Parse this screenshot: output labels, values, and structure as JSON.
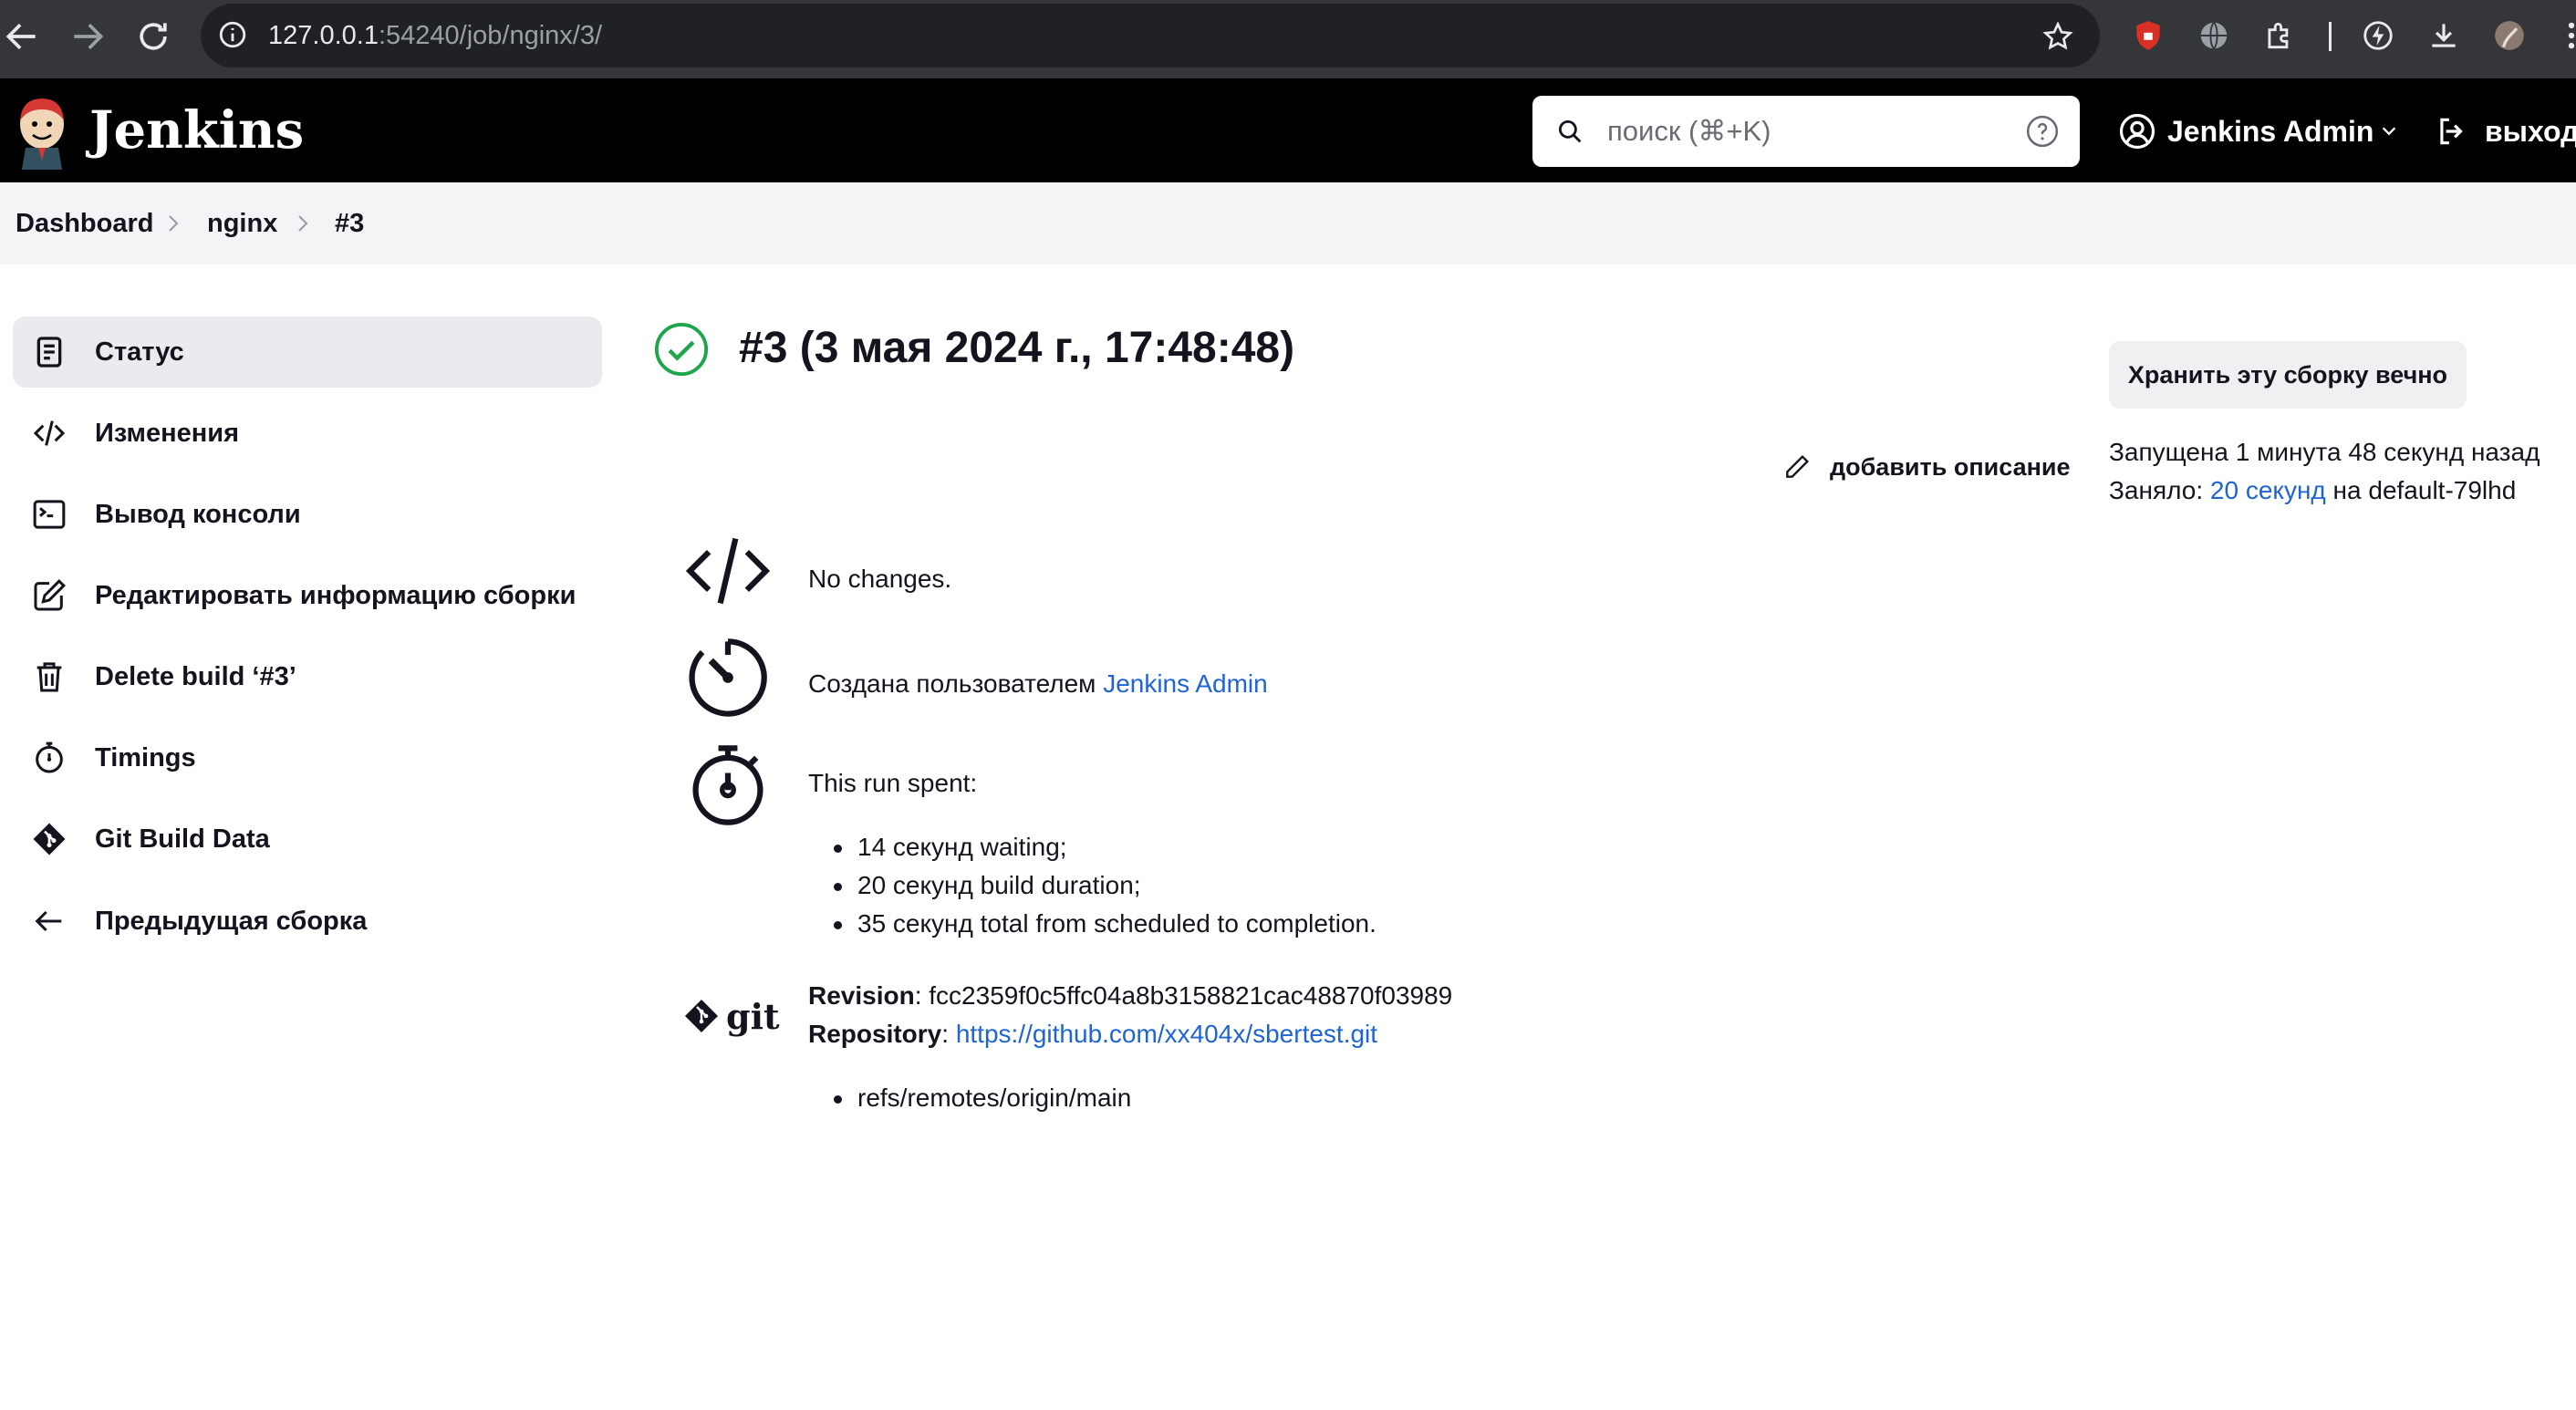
{
  "browser": {
    "url_host": "127.0.0.1",
    "url_path": ":54240/job/nginx/3/"
  },
  "header": {
    "logo_text": "Jenkins",
    "search_placeholder": "поиск (⌘+K)",
    "user_name": "Jenkins Admin",
    "logout_label": "выход"
  },
  "breadcrumb": [
    "Dashboard",
    "nginx",
    "#3"
  ],
  "sidebar": {
    "items": [
      {
        "label": "Статус",
        "icon": "document-icon",
        "active": true
      },
      {
        "label": "Изменения",
        "icon": "code-icon"
      },
      {
        "label": "Вывод консоли",
        "icon": "terminal-icon"
      },
      {
        "label": "Редактировать информацию сборки",
        "icon": "edit-icon"
      },
      {
        "label": "Delete build ‘#3’",
        "icon": "trash-icon"
      },
      {
        "label": "Timings",
        "icon": "stopwatch-icon"
      },
      {
        "label": "Git Build Data",
        "icon": "git-icon"
      },
      {
        "label": "Предыдущая сборка",
        "icon": "arrow-left-icon"
      }
    ]
  },
  "build": {
    "title": "#3 (3 мая 2024 г., 17:48:48)",
    "status": "success",
    "add_description": "добавить описание",
    "changes_text": "No changes.",
    "created_by_prefix": "Создана пользователем ",
    "created_by_user": "Jenkins Admin",
    "run_spent_label": "This run spent:",
    "run_spent_items": [
      "14 секунд waiting;",
      "20 секунд build duration;",
      "35 секунд total from scheduled to completion."
    ],
    "git": {
      "logo_text": "git",
      "revision_label": "Revision",
      "revision": "fcc2359f0c5ffc04a8b3158821cac48870f03989",
      "repository_label": "Repository",
      "repository": "https://github.com/xx404x/sbertest.git",
      "refs": [
        "refs/remotes/origin/main"
      ]
    }
  },
  "side_panel": {
    "keep_button": "Хранить эту сборку вечно",
    "started": "Запущена 1 минута 48 секунд назад",
    "took_prefix": "Заняло: ",
    "took_duration": "20 секунд",
    "took_suffix": " на default-79lhd"
  },
  "colors": {
    "accent_link": "#1f64d3",
    "success": "#1ea64b",
    "header_bg": "#000000"
  }
}
